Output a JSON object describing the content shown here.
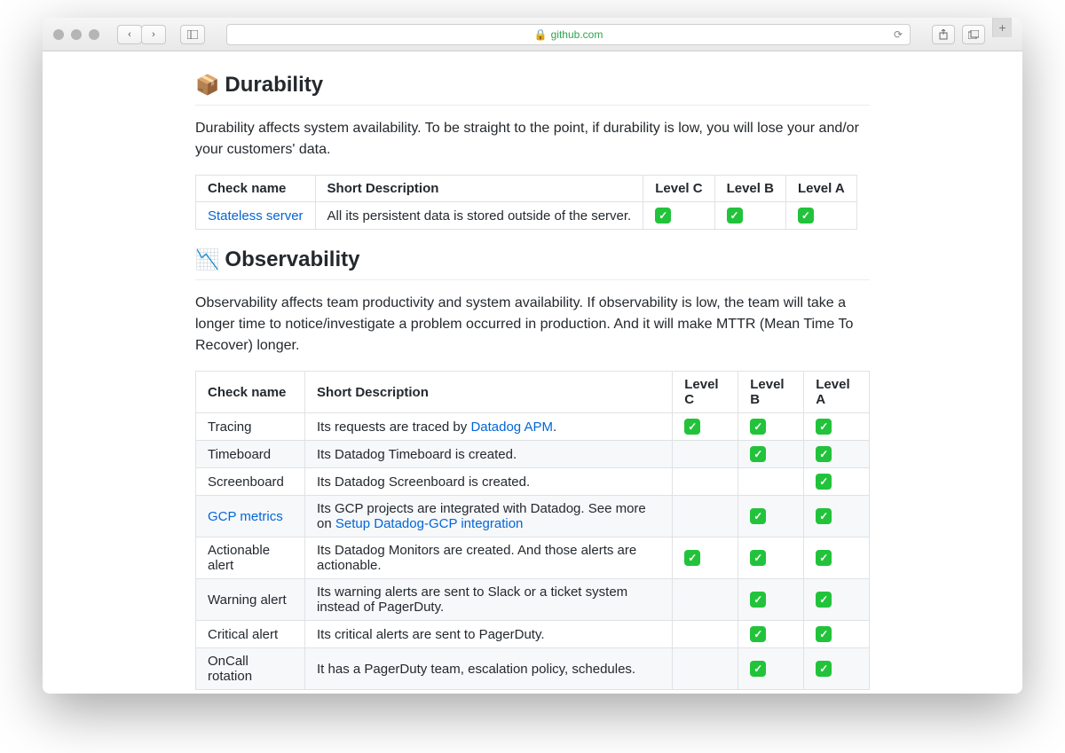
{
  "browser": {
    "domain": "github.com"
  },
  "sections": [
    {
      "emoji": "📦",
      "title": "Durability",
      "description": "Durability affects system availability. To be straight to the point, if durability is low, you will lose your and/or your customers' data.",
      "headers": [
        "Check name",
        "Short Description",
        "Level C",
        "Level B",
        "Level A"
      ],
      "rows": [
        {
          "name": "Stateless server",
          "name_link": true,
          "desc": "All its persistent data is stored outside of the server.",
          "c": true,
          "b": true,
          "a": true
        }
      ]
    },
    {
      "emoji": "📉",
      "title": "Observability",
      "description": "Observability affects team productivity and system availability. If observability is low, the team will take a longer time to notice/investigate a problem occurred in production. And it will make MTTR (Mean Time To Recover) longer.",
      "headers": [
        "Check name",
        "Short Description",
        "Level C",
        "Level B",
        "Level A"
      ],
      "rows": [
        {
          "name": "Tracing",
          "desc_prefix": "Its requests are traced by ",
          "desc_link": "Datadog APM",
          "desc_suffix": ".",
          "c": true,
          "b": true,
          "a": true
        },
        {
          "name": "Timeboard",
          "desc": "Its Datadog Timeboard is created.",
          "c": false,
          "b": true,
          "a": true
        },
        {
          "name": "Screenboard",
          "desc": "Its Datadog Screenboard is created.",
          "c": false,
          "b": false,
          "a": true
        },
        {
          "name": "GCP metrics",
          "name_link": true,
          "desc_prefix": "Its GCP projects are integrated with Datadog. See more on ",
          "desc_link": "Setup Datadog-GCP integration",
          "desc_suffix": "",
          "c": false,
          "b": true,
          "a": true
        },
        {
          "name": "Actionable alert",
          "desc": "Its Datadog Monitors are created. And those alerts are actionable.",
          "c": true,
          "b": true,
          "a": true
        },
        {
          "name": "Warning alert",
          "desc": "Its warning alerts are sent to Slack or a ticket system instead of PagerDuty.",
          "c": false,
          "b": true,
          "a": true
        },
        {
          "name": "Critical alert",
          "desc": "Its critical alerts are sent to PagerDuty.",
          "c": false,
          "b": true,
          "a": true
        },
        {
          "name": "OnCall rotation",
          "desc": "It has a PagerDuty team, escalation policy, schedules.",
          "c": false,
          "b": true,
          "a": true
        }
      ]
    }
  ]
}
